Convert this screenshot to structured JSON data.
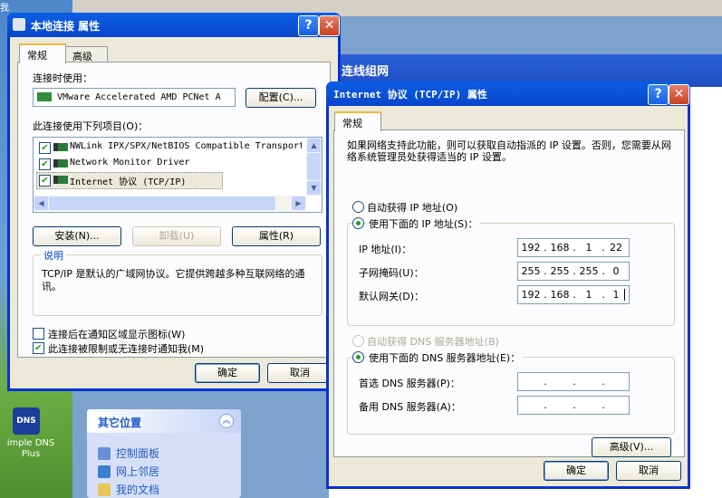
{
  "background": {
    "explorer_title": "连线组网",
    "other_places": {
      "header": "其它位置",
      "items": [
        "控制面板",
        "网上邻居",
        "我的文档"
      ]
    },
    "desktop_icon_label": "imple DNS Plus",
    "desktop_icon_badge": "DNS",
    "partial_text": "我"
  },
  "lan_dialog": {
    "title": "本地连接 属性",
    "help": "?",
    "close": "✕",
    "tabs": [
      "常规",
      "高级"
    ],
    "connect_using_label": "连接时使用：",
    "adapter": "VMware Accelerated AMD PCNet A",
    "configure_button": "配置(C)...",
    "items_label": "此连接使用下列项目(O)：",
    "items": [
      {
        "label": "NWLink IPX/SPX/NetBIOS Compatible Transport",
        "checked": true
      },
      {
        "label": "Network Monitor Driver",
        "checked": true
      },
      {
        "label": "Internet 协议 (TCP/IP)",
        "checked": true
      }
    ],
    "install_button": "安装(N)...",
    "uninstall_button": "卸载(U)",
    "properties_button": "属性(R)",
    "description_label": "说明",
    "description_text": "TCP/IP 是默认的广域网协议。它提供跨越多种互联网络的通讯。",
    "show_icon_label": "连接后在通知区域显示图标(W)",
    "show_icon_checked": false,
    "notify_label": "此连接被限制或无连接时通知我(M)",
    "notify_checked": true,
    "ok_button": "确定",
    "cancel_button": "取消"
  },
  "tcpip_dialog": {
    "title": "Internet 协议 (TCP/IP) 属性",
    "help": "?",
    "close": "✕",
    "tab": "常规",
    "intro": "如果网络支持此功能，则可以获取自动指派的 IP 设置。否则，您需要从网络系统管理员处获得适当的 IP 设置。",
    "auto_ip_label": "自动获得 IP 地址(O)",
    "manual_ip_label": "使用下面的 IP 地址(S)：",
    "ip_label": "IP 地址(I)：",
    "ip": [
      "192",
      "168",
      "1",
      "22"
    ],
    "mask_label": "子网掩码(U)：",
    "mask": [
      "255",
      "255",
      "255",
      "0"
    ],
    "gateway_label": "默认网关(D)：",
    "gateway": [
      "192",
      "168",
      "1",
      "1"
    ],
    "auto_dns_label": "自动获得 DNS 服务器地址(B)",
    "manual_dns_label": "使用下面的 DNS 服务器地址(E)：",
    "preferred_dns_label": "首选 DNS 服务器(P)：",
    "alternate_dns_label": "备用 DNS 服务器(A)：",
    "advanced_button": "高级(V)...",
    "ok_button": "确定",
    "cancel_button": "取消"
  }
}
